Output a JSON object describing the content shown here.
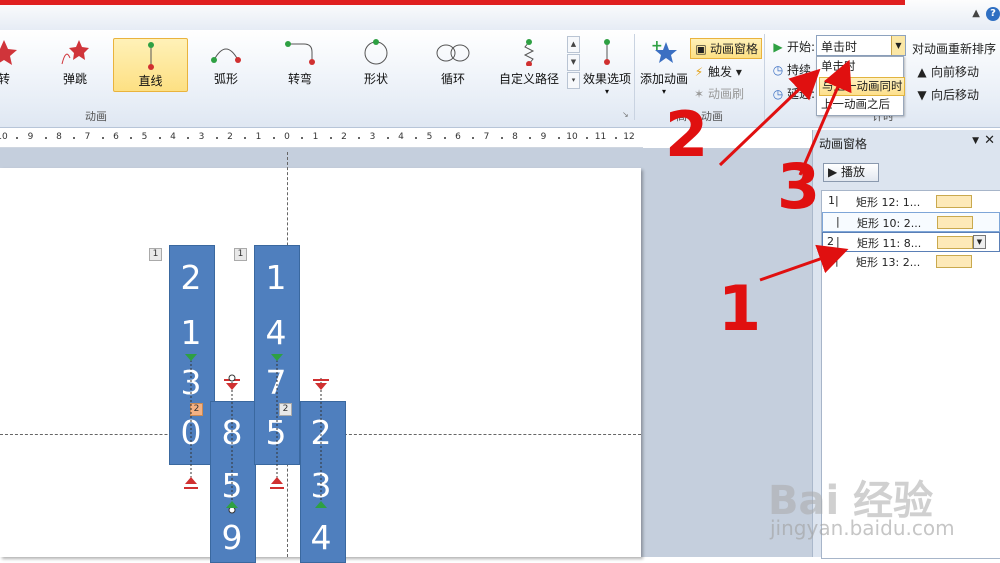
{
  "gallery": {
    "items": [
      {
        "label": "转",
        "icon": "spin-star-icon"
      },
      {
        "label": "弹跳",
        "icon": "bounce-star-icon"
      },
      {
        "label": "直线",
        "icon": "line-path-icon"
      },
      {
        "label": "弧形",
        "icon": "arc-path-icon"
      },
      {
        "label": "转弯",
        "icon": "turn-path-icon"
      },
      {
        "label": "形状",
        "icon": "shape-path-icon"
      },
      {
        "label": "循环",
        "icon": "loop-path-icon"
      },
      {
        "label": "自定义路径",
        "icon": "custom-path-icon"
      }
    ],
    "effect_options_label": "效果选项",
    "group_label": "动画"
  },
  "advanced": {
    "add_animation_label": "添加动画",
    "animation_pane_label": "动画窗格",
    "trigger_label": "触发",
    "animation_painter_label": "动画刷",
    "group_label_partial": "高",
    "group_label_partial2": "动画"
  },
  "timing": {
    "start_label": "开始:",
    "start_value": "单击时",
    "duration_label": "持续",
    "delay_label": "延迟:",
    "options": [
      "单击时",
      "与上一动画同时",
      "上一动画之后"
    ],
    "reorder_title": "对动画重新排序",
    "move_earlier": "向前移动",
    "move_later": "向后移动",
    "group_label_partial": "计时"
  },
  "ruler": {
    "ticks": [
      "10",
      "9",
      "8",
      "7",
      "6",
      "5",
      "4",
      "3",
      "2",
      "1",
      "0",
      "1",
      "2",
      "3",
      "4",
      "5",
      "6",
      "7",
      "8",
      "9",
      "10",
      "11",
      "12"
    ]
  },
  "slide": {
    "columns": [
      {
        "digits": [
          "2",
          "1",
          "3",
          "0"
        ],
        "tag": "1"
      },
      {
        "digits": [
          "8",
          "5",
          "9"
        ],
        "tag": "2"
      },
      {
        "digits": [
          "1",
          "4",
          "7",
          "5"
        ],
        "tag": "1"
      },
      {
        "digits": [
          "2",
          "3",
          "4"
        ],
        "tag": "2"
      }
    ]
  },
  "pane": {
    "title": "动画窗格",
    "play_label": "播放",
    "items": [
      {
        "num": "1",
        "text": "矩形 12: 1..."
      },
      {
        "num": "",
        "text": "矩形 10: 2..."
      },
      {
        "num": "2",
        "text": "矩形 11: 8..."
      },
      {
        "num": "",
        "text": "矩形 13: 2..."
      }
    ]
  },
  "annotations": [
    "2",
    "3",
    "1"
  ],
  "watermark": {
    "line1": "Bai  经验",
    "line2": "jingyan.baidu.com"
  },
  "colors": {
    "accent_red": "#e01010",
    "shape_blue": "#4f7fbe",
    "selection_gold": "#fde083"
  }
}
